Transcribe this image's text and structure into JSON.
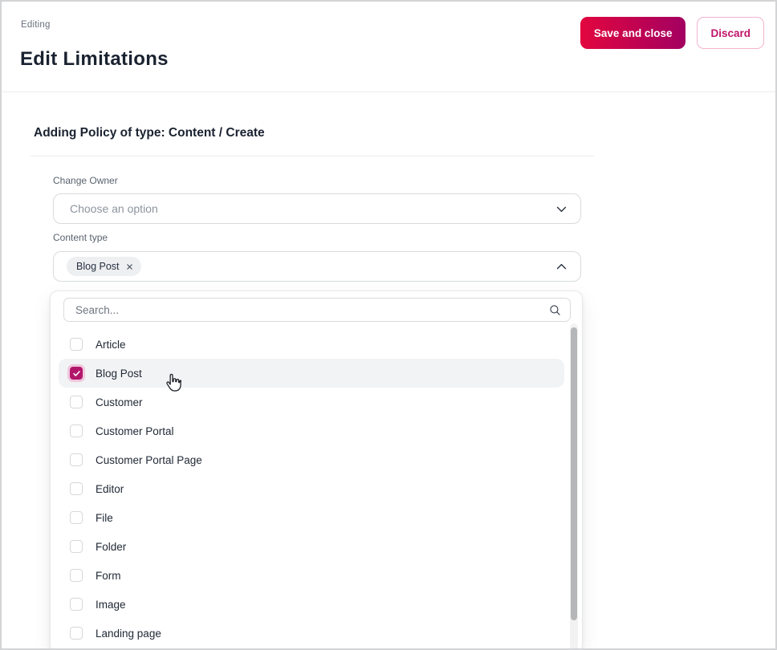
{
  "header": {
    "breadcrumb": "Editing",
    "title": "Edit Limitations",
    "buttons": {
      "save": "Save and close",
      "discard": "Discard"
    }
  },
  "form": {
    "section_title": "Adding Policy of type: Content / Create",
    "fields": {
      "change_owner": {
        "label": "Change Owner",
        "placeholder": "Choose an option"
      },
      "content_type": {
        "label": "Content type",
        "selected_chip": "Blog Post",
        "chip_remove_glyph": "×"
      }
    }
  },
  "dropdown": {
    "search": {
      "placeholder": "Search...",
      "value": ""
    },
    "options": [
      {
        "label": "Article",
        "checked": false,
        "highlighted": false
      },
      {
        "label": "Blog Post",
        "checked": true,
        "highlighted": true
      },
      {
        "label": "Customer",
        "checked": false,
        "highlighted": false
      },
      {
        "label": "Customer Portal",
        "checked": false,
        "highlighted": false
      },
      {
        "label": "Customer Portal Page",
        "checked": false,
        "highlighted": false
      },
      {
        "label": "Editor",
        "checked": false,
        "highlighted": false
      },
      {
        "label": "File",
        "checked": false,
        "highlighted": false
      },
      {
        "label": "Folder",
        "checked": false,
        "highlighted": false
      },
      {
        "label": "Form",
        "checked": false,
        "highlighted": false
      },
      {
        "label": "Image",
        "checked": false,
        "highlighted": false
      },
      {
        "label": "Landing page",
        "checked": false,
        "highlighted": false
      }
    ]
  },
  "colors": {
    "save_gradient_start": "#e2063f",
    "save_gradient_end": "#a30061",
    "discard_text": "#c0136a",
    "discard_border": "#f2b3cf",
    "checkbox_checked": "#b2166b",
    "checkbox_ring": "#efc8dd",
    "highlight_row": "#f2f3f4"
  }
}
